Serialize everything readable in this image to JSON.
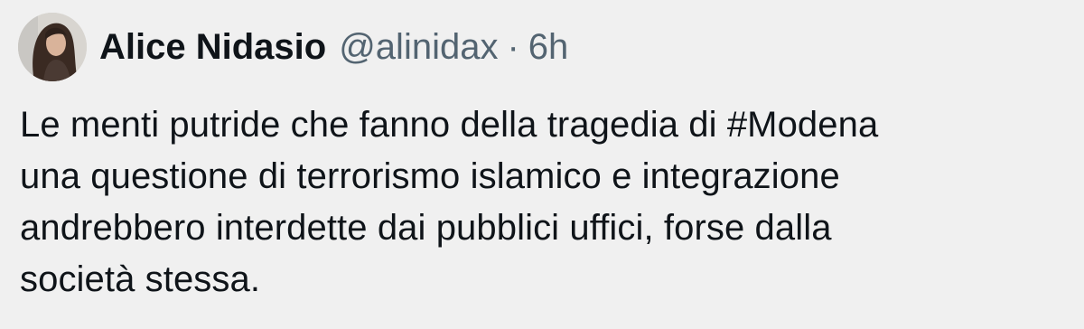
{
  "author": {
    "display_name": "Alice Nidasio",
    "handle": "@alinidax",
    "separator": "·",
    "time": "6h"
  },
  "tweet": {
    "lines": [
      {
        "before": "Le menti putride che fanno della tragedia di ",
        "hashtag": "#Modena",
        "after": ""
      },
      {
        "before": "una questione di terrorismo islamico e integrazione",
        "hashtag": "",
        "after": ""
      },
      {
        "before": "andrebbero interdette dai pubblici uffici, forse dalla",
        "hashtag": "",
        "after": ""
      },
      {
        "before": "società stessa.",
        "hashtag": "",
        "after": ""
      }
    ]
  },
  "colors": {
    "background": "#f0f0f0",
    "text": "#0f1419",
    "secondary_text": "#536471"
  }
}
